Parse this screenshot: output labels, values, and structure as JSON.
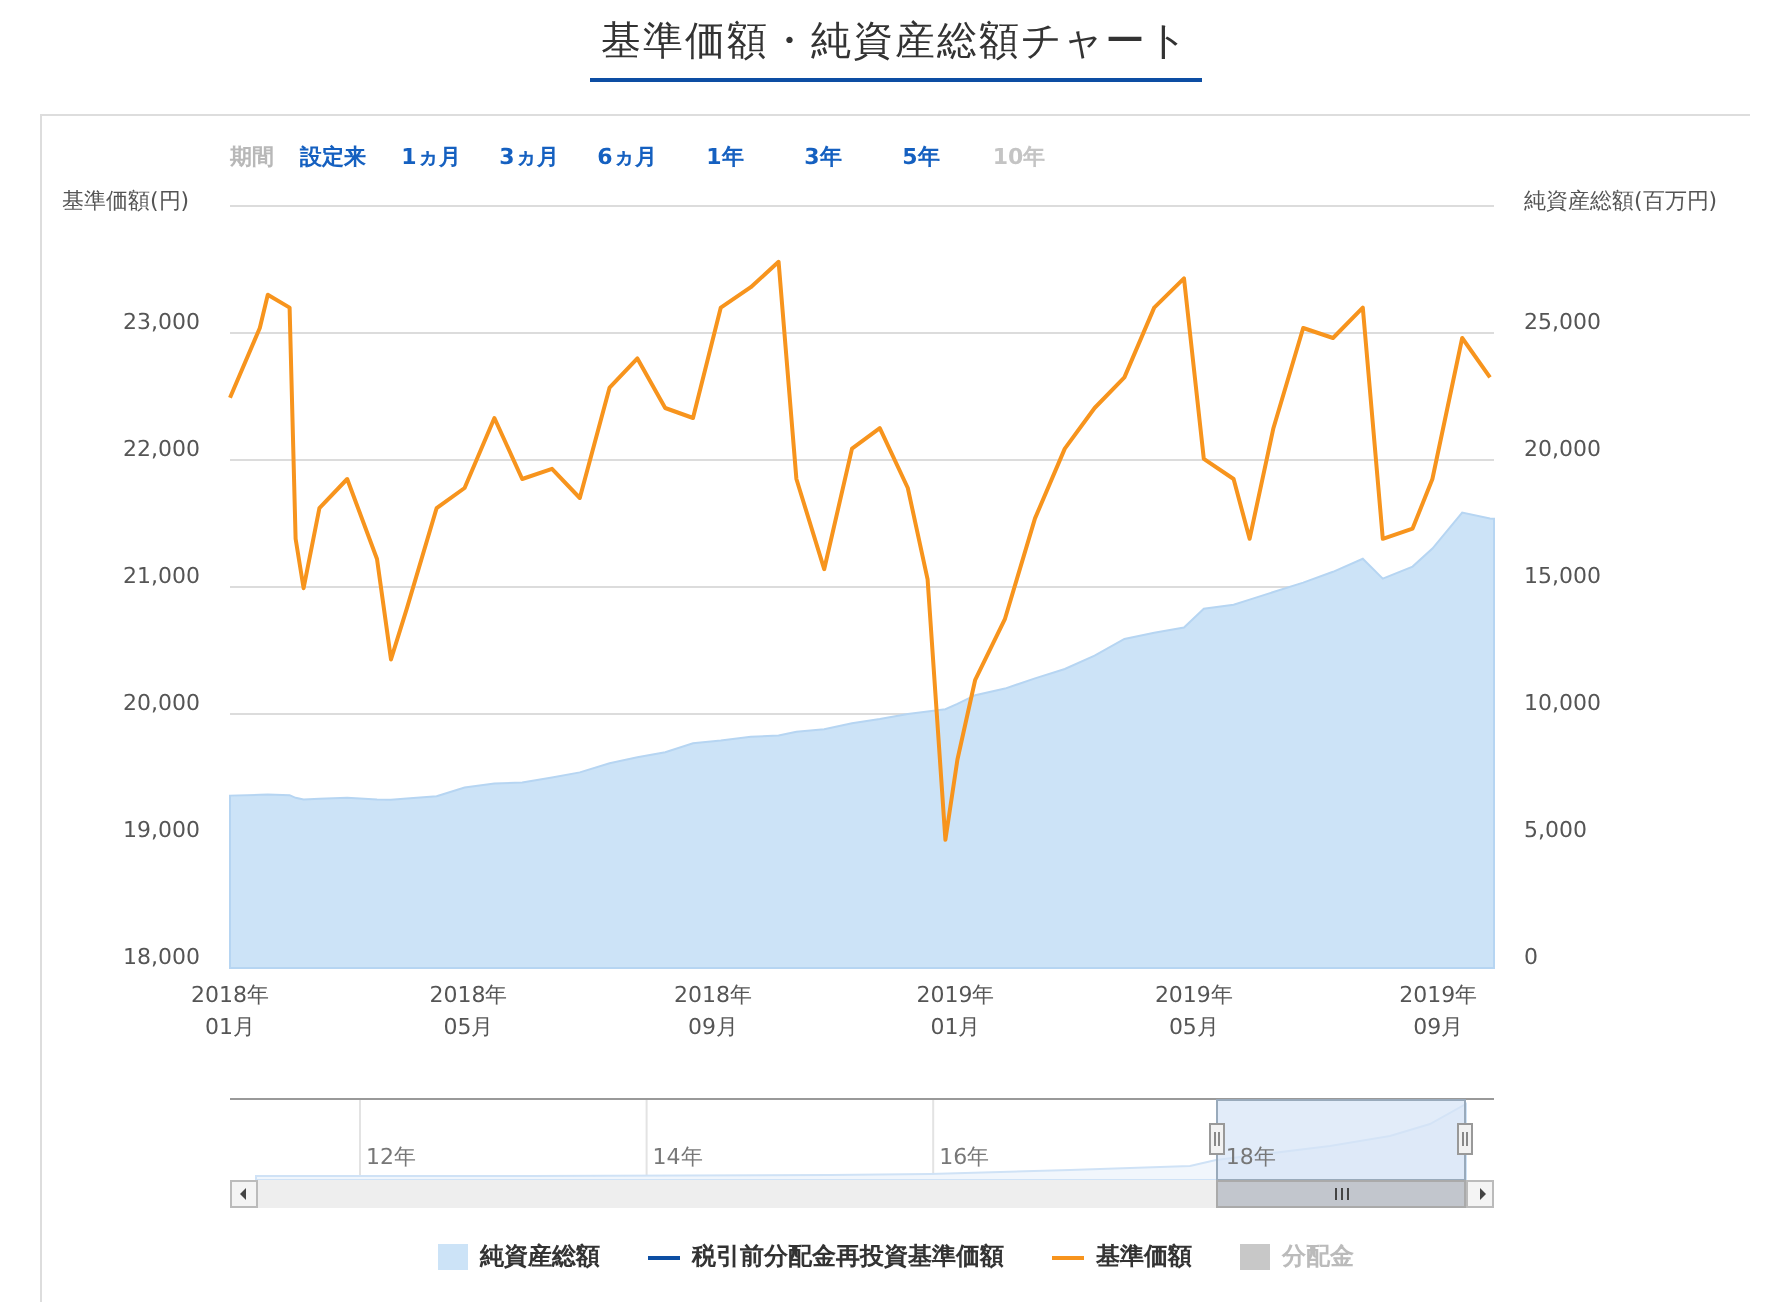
{
  "title": "基準価額・純資産総額チャート",
  "periods": {
    "label": "期間",
    "buttons": [
      {
        "label": "設定来",
        "disabled": false
      },
      {
        "label": "1ヵ月",
        "disabled": false
      },
      {
        "label": "3ヵ月",
        "disabled": false
      },
      {
        "label": "6ヵ月",
        "disabled": false
      },
      {
        "label": "1年",
        "disabled": false
      },
      {
        "label": "3年",
        "disabled": false
      },
      {
        "label": "5年",
        "disabled": false
      },
      {
        "label": "10年",
        "disabled": true
      }
    ]
  },
  "chart": {
    "chart_data": {
      "type": "line",
      "ylabel": "基準価額(円)",
      "y2label": "純資産総額(百万円)",
      "x": [
        "2018-01-01",
        "2018-01-16",
        "2018-01-20",
        "2018-01-31",
        "2018-02-03",
        "2018-02-07",
        "2018-02-15",
        "2018-03-01",
        "2018-03-16",
        "2018-03-23",
        "2018-03-31",
        "2018-04-15",
        "2018-04-29",
        "2018-05-14",
        "2018-05-28",
        "2018-06-12",
        "2018-06-26",
        "2018-07-11",
        "2018-07-25",
        "2018-08-08",
        "2018-08-22",
        "2018-09-05",
        "2018-09-20",
        "2018-10-04",
        "2018-10-13",
        "2018-10-27",
        "2018-11-10",
        "2018-11-24",
        "2018-12-08",
        "2018-12-18",
        "2018-12-27",
        "2019-01-02",
        "2019-01-11",
        "2019-01-26",
        "2019-02-10",
        "2019-02-25",
        "2019-03-12",
        "2019-03-27",
        "2019-04-11",
        "2019-04-26",
        "2019-05-06",
        "2019-05-21",
        "2019-05-29",
        "2019-06-10",
        "2019-06-25",
        "2019-07-10",
        "2019-07-25",
        "2019-08-04",
        "2019-08-19",
        "2019-08-29",
        "2019-09-13",
        "2019-09-27"
      ],
      "xlim": [
        "2018-01-01",
        "2019-09-29"
      ],
      "xticks": [
        {
          "value": "2018-01-01",
          "label": "2018年\n01月"
        },
        {
          "value": "2018-05-01",
          "label": "2018年\n05月"
        },
        {
          "value": "2018-09-01",
          "label": "2018年\n09月"
        },
        {
          "value": "2019-01-01",
          "label": "2019年\n01月"
        },
        {
          "value": "2019-05-01",
          "label": "2019年\n05月"
        },
        {
          "value": "2019-09-01",
          "label": "2019年\n09月"
        }
      ],
      "ylim": [
        18000,
        24000
      ],
      "yticks": [
        {
          "value": 18000,
          "label": "18,000"
        },
        {
          "value": 19000,
          "label": "19,000"
        },
        {
          "value": 20000,
          "label": "20,000"
        },
        {
          "value": 21000,
          "label": "21,000"
        },
        {
          "value": 22000,
          "label": "22,000"
        },
        {
          "value": 23000,
          "label": "23,000"
        }
      ],
      "grid": true,
      "y2lim": [
        0,
        30000
      ],
      "y2ticks": [
        {
          "value": 0,
          "label": "0"
        },
        {
          "value": 5000,
          "label": "5,000"
        },
        {
          "value": 10000,
          "label": "10,000"
        },
        {
          "value": 15000,
          "label": "15,000"
        },
        {
          "value": 20000,
          "label": "20,000"
        },
        {
          "value": 25000,
          "label": "25,000"
        }
      ],
      "series": [
        {
          "name": "純資産総額",
          "type": "area",
          "axis": "y2",
          "color": "#cce3f7",
          "values": [
            6790,
            6820,
            6830,
            6800,
            6700,
            6640,
            6660,
            6700,
            6640,
            6620,
            6680,
            6760,
            7100,
            7270,
            7300,
            7500,
            7700,
            8060,
            8300,
            8500,
            8850,
            8950,
            9100,
            9160,
            9300,
            9400,
            9640,
            9800,
            10000,
            10100,
            10190,
            10400,
            10740,
            11000,
            11400,
            11770,
            12300,
            12950,
            13200,
            13400,
            14140,
            14300,
            14500,
            14800,
            15170,
            15600,
            16110,
            15330,
            15800,
            16510,
            17930,
            17690
          ]
        },
        {
          "name": "基準価額",
          "type": "line",
          "color": "#f7941d",
          "values": [
            22490,
            23040,
            23300,
            23200,
            21380,
            20990,
            21620,
            21850,
            21220,
            20430,
            20830,
            21620,
            21780,
            22330,
            21850,
            21930,
            21700,
            22570,
            22800,
            22410,
            22330,
            23200,
            23360,
            23560,
            21850,
            21140,
            22090,
            22250,
            21780,
            21060,
            19010,
            19640,
            20270,
            20750,
            21540,
            22090,
            22410,
            22650,
            23200,
            23430,
            22010,
            21850,
            21380,
            22250,
            23040,
            22960,
            23200,
            21380,
            21460,
            21850,
            22960,
            22650
          ]
        }
      ]
    }
  },
  "navigator": {
    "labels": [
      "12年",
      "14年",
      "16年",
      "18年"
    ]
  },
  "legend": [
    {
      "kind": "series",
      "disabled": false
    },
    {
      "label": "税引前分配金再投資基準価額",
      "kind": "line",
      "color": "#0d4ea3",
      "disabled": false
    },
    {
      "kind": "series",
      "disabled": false
    },
    {
      "label": "分配金",
      "kind": "area",
      "color": "#c8c8c8",
      "disabled": true
    }
  ]
}
